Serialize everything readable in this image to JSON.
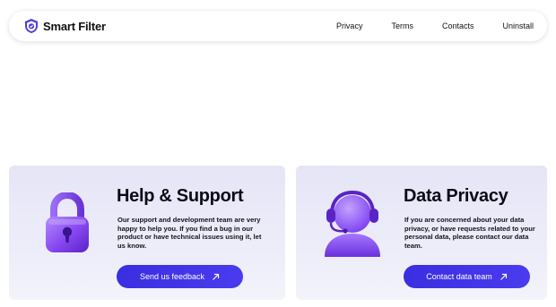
{
  "header": {
    "brand_name": "Smart Filter",
    "nav": [
      "Privacy",
      "Terms",
      "Contacts",
      "Uninstall"
    ]
  },
  "cards": [
    {
      "title": "Help & Support",
      "text": "Our support and development team are very happy to help you. If you find a bug in our product or have technical issues using it, let us know.",
      "button_label": "Send us feedback",
      "illustration": "padlock-icon"
    },
    {
      "title": "Data Privacy",
      "text": "If you are concerned about your data privacy, or have requests related to your personal data, please contact our data team.",
      "button_label": "Contact data team",
      "illustration": "support-agent-headset-icon"
    }
  ],
  "colors": {
    "accent": "#3b30e4",
    "card_bg": "#e8e8f8",
    "illustration_purple": "#8a4cf0"
  }
}
